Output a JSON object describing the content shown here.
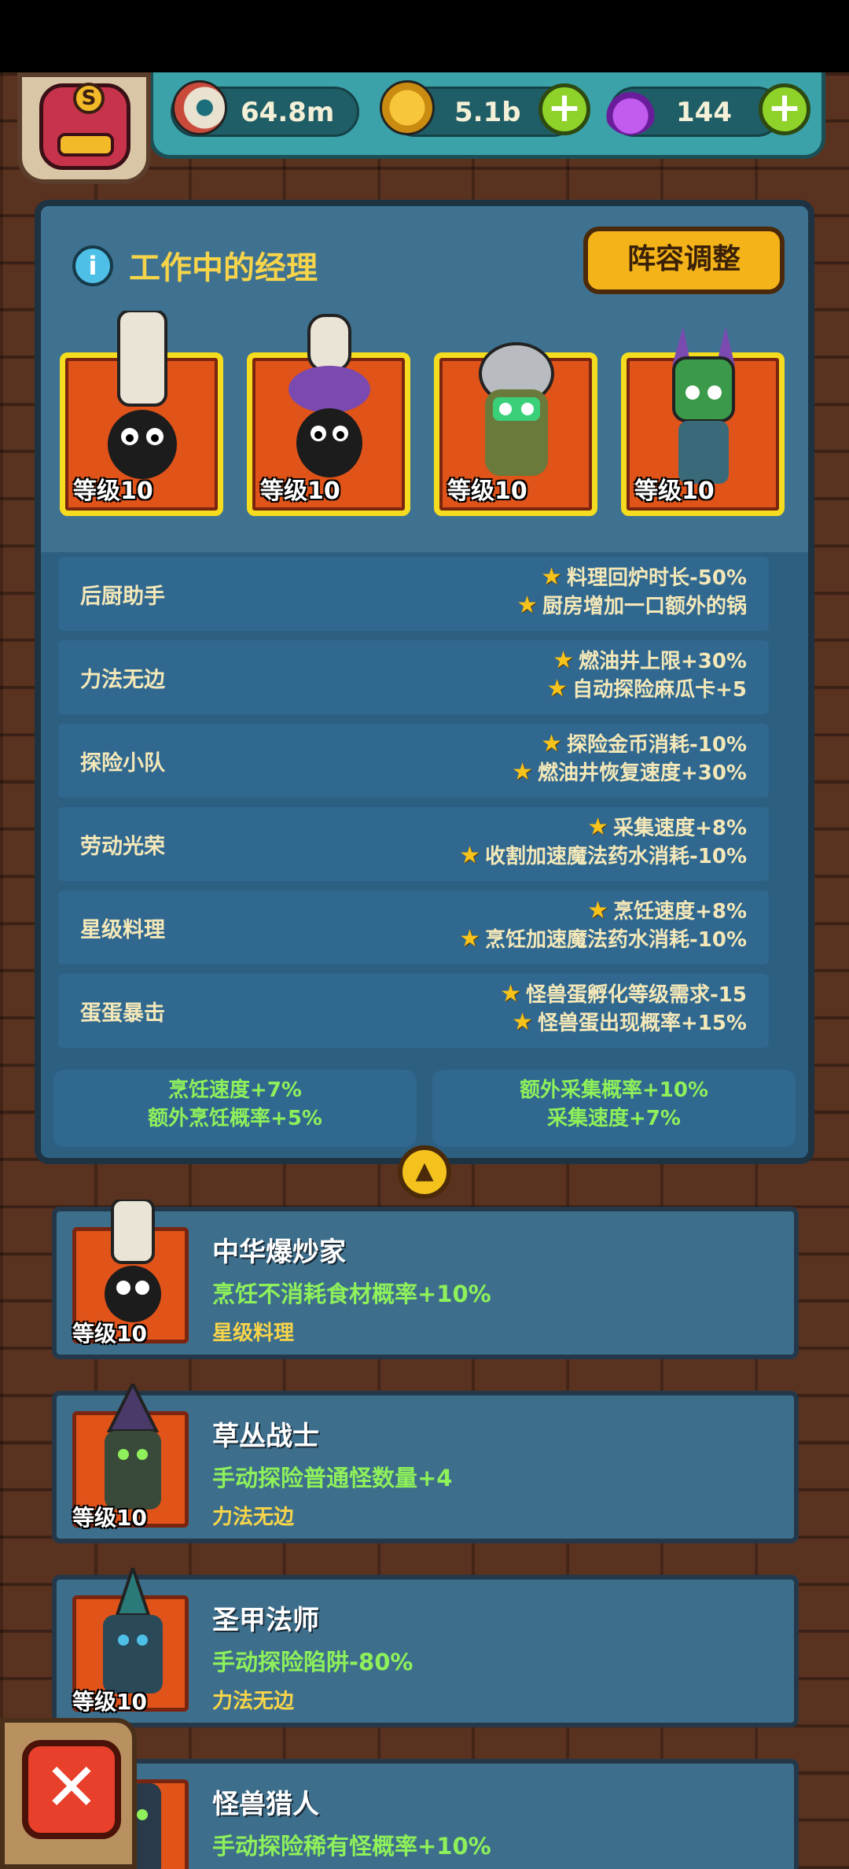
{
  "currency": {
    "eyeballs": "64.8m",
    "coins": "5.1b",
    "potions": "144",
    "logo_letter": "S"
  },
  "panel": {
    "title": "工作中的经理",
    "lineup_button": "阵容调整"
  },
  "working_managers": [
    {
      "level": "等级10"
    },
    {
      "level": "等级10"
    },
    {
      "level": "等级10"
    },
    {
      "level": "等级10"
    }
  ],
  "bonuses": [
    {
      "name": "后厨助手",
      "effects": [
        "料理回炉时长-50%",
        "厨房增加一口额外的锅"
      ]
    },
    {
      "name": "力法无边",
      "effects": [
        "燃油井上限+30%",
        "自动探险麻瓜卡+5"
      ]
    },
    {
      "name": "探险小队",
      "effects": [
        "探险金币消耗-10%",
        "燃油井恢复速度+30%"
      ]
    },
    {
      "name": "劳动光荣",
      "effects": [
        "采集速度+8%",
        "收割加速魔法药水消耗-10%"
      ]
    },
    {
      "name": "星级料理",
      "effects": [
        "烹饪速度+8%",
        "烹饪加速魔法药水消耗-10%"
      ]
    },
    {
      "name": "蛋蛋暴击",
      "effects": [
        "怪兽蛋孵化等级需求-15",
        "怪兽蛋出现概率+15%"
      ]
    }
  ],
  "summary": {
    "left": [
      "烹饪速度+7%",
      "额外烹饪概率+5%"
    ],
    "right": [
      "额外采集概率+10%",
      "采集速度+7%"
    ]
  },
  "roster": [
    {
      "level": "等级10",
      "name": "中华爆炒家",
      "effect": "烹饪不消耗食材概率+10%",
      "group": "星级料理"
    },
    {
      "level": "等级10",
      "name": "草丛战士",
      "effect": "手动探险普通怪数量+4",
      "group": "力法无边"
    },
    {
      "level": "等级10",
      "name": "圣甲法师",
      "effect": "手动探险陷阱-80%",
      "group": "力法无边"
    },
    {
      "level": "",
      "name": "怪兽猎人",
      "effect": "手动探险稀有怪概率+10%",
      "group": ""
    }
  ],
  "icons": {
    "eyeball": "eyeball-icon",
    "coin": "coin-icon",
    "potion": "potion-icon",
    "plus": "plus-icon",
    "info": "info-icon",
    "star": "star-icon",
    "collapse": "chevron-up-icon",
    "close": "close-icon"
  },
  "colors": {
    "title_yellow": "#f7d44a",
    "effect_green": "#8ef05a",
    "card_orange": "#e05319",
    "card_border": "#f5dc1e"
  }
}
